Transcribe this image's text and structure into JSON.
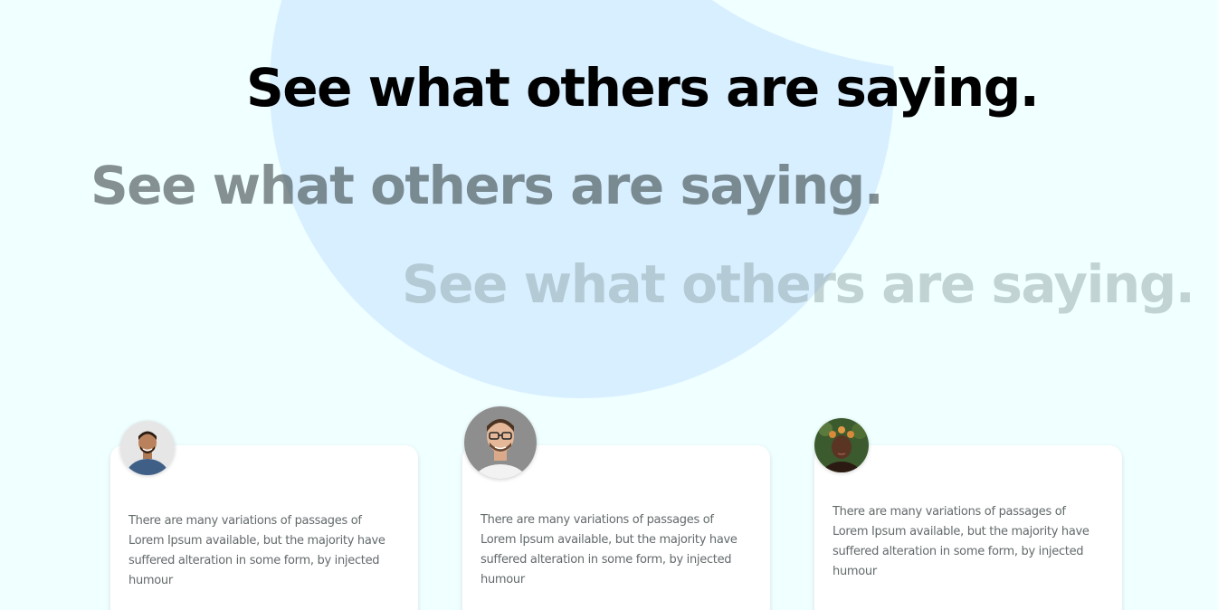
{
  "headlines": [
    "See what others are saying.",
    "See what others are saying.",
    "See what others are saying."
  ],
  "testimonials": [
    {
      "avatar_icon": "person-avatar-icon",
      "text": "There are many variations of passages of Lorem Ipsum available, but the majority have suffered alteration in some form, by injected humour"
    },
    {
      "avatar_icon": "person-avatar-icon",
      "text": "There are many variations of passages of Lorem Ipsum available, but the majority have suffered alteration in some form, by injected humour"
    },
    {
      "avatar_icon": "person-avatar-icon",
      "text": "There are many variations of passages of Lorem Ipsum available, but the majority have suffered alteration in some form, by injected humour"
    }
  ],
  "colors": {
    "background": "#f0ffff",
    "blob": "#d8efff",
    "headline_primary": "#000000",
    "card_text": "#636a6c"
  }
}
